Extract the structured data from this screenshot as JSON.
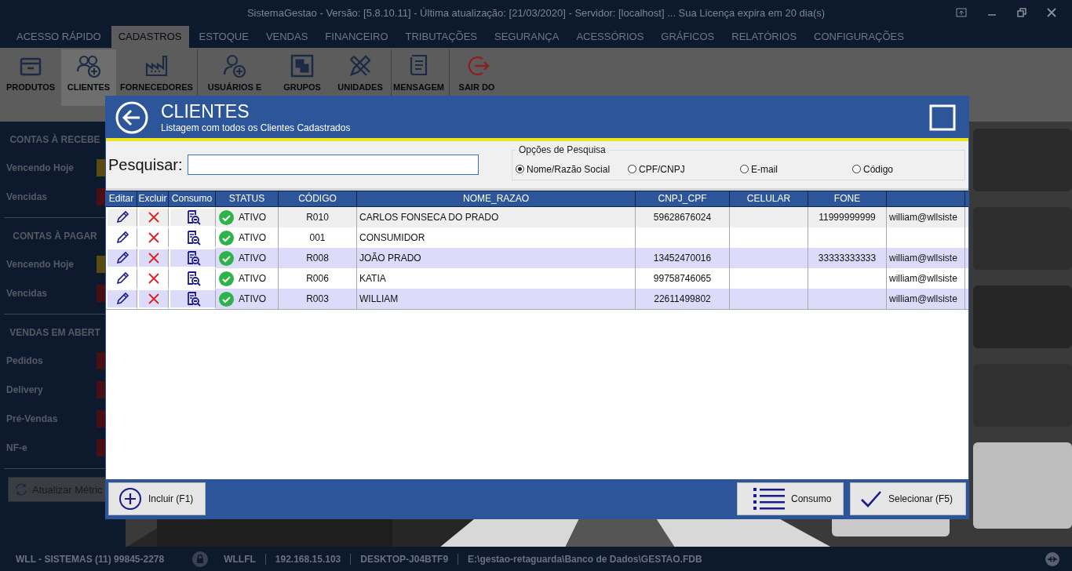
{
  "window": {
    "title": "SistemaGestao - Versão: [5.8.10.11] - Última atualização: [21/03/2020] - Servidor: [localhost] ... Sua Licença expira em 20 dia(s)"
  },
  "menu_tabs": [
    {
      "label": "ACESSO RÁPIDO",
      "selected": false
    },
    {
      "label": "CADASTROS",
      "selected": true
    },
    {
      "label": "ESTOQUE",
      "selected": false
    },
    {
      "label": "VENDAS",
      "selected": false
    },
    {
      "label": "FINANCEIRO",
      "selected": false
    },
    {
      "label": "TRIBUTAÇÕES",
      "selected": false
    },
    {
      "label": "SEGURANÇA",
      "selected": false
    },
    {
      "label": "ACESSÓRIOS",
      "selected": false
    },
    {
      "label": "GRÁFICOS",
      "selected": false
    },
    {
      "label": "RELATÓRIOS",
      "selected": false
    },
    {
      "label": "CONFIGURAÇÕES",
      "selected": false
    }
  ],
  "ribbon": [
    {
      "kind": "box",
      "label": "PRODUTOS",
      "selected": false
    },
    {
      "kind": "people",
      "label": "CLIENTES",
      "selected": true
    },
    {
      "kind": "factory",
      "label": "FORNECEDORES",
      "selected": false
    },
    {
      "kind": "user",
      "label": "USUÁRIOS E",
      "selected": false
    },
    {
      "kind": "group",
      "label": "GRUPOS",
      "selected": false
    },
    {
      "kind": "tools",
      "label": "UNIDADES",
      "selected": false
    },
    {
      "kind": "scroll",
      "label": "MENSAGEM",
      "selected": false
    },
    {
      "kind": "exit",
      "label": "SAIR DO",
      "selected": false
    }
  ],
  "sidebar": [
    {
      "heading": "CONTAS À RECEBE",
      "items": [
        {
          "label": "Vencendo Hoje",
          "color": "#5a4a14"
        },
        {
          "label": "Vencidas",
          "color": "#4a0f14"
        }
      ]
    },
    {
      "heading": "CONTAS À PAGAR",
      "items": [
        {
          "label": "Vencendo Hoje",
          "color": "#5a4a14"
        },
        {
          "label": "Vencidas",
          "color": "#4a0f14"
        }
      ]
    },
    {
      "heading": "VENDAS EM ABERT",
      "items": [
        {
          "label": "Pedidos",
          "color": "#4a0f14"
        },
        {
          "label": "Delivery",
          "color": "#4a0f14"
        },
        {
          "label": "Pré-Vendas",
          "color": "#4a0f14"
        },
        {
          "label": "NF-e",
          "color": "#4a0f14"
        }
      ]
    }
  ],
  "refresh_button": "Atualizar Métric",
  "dialog": {
    "title": "CLIENTES",
    "subtitle": "Listagem com todos os Clientes Cadastrados",
    "search": {
      "label": "Pesquisar:"
    },
    "search_options": {
      "title": "Opções de Pesquisa",
      "options": [
        {
          "label": "Nome/Razão Social",
          "selected": true
        },
        {
          "label": "CPF/CNPJ",
          "selected": false
        },
        {
          "label": "E-mail",
          "selected": false
        },
        {
          "label": "Código",
          "selected": false
        }
      ]
    },
    "table": {
      "columns": [
        "Editar",
        "Excluir",
        "Consumo",
        "STATUS",
        "CÓDIGO",
        "NOME_RAZAO",
        "CNPJ_CPF",
        "CELULAR",
        "FONE"
      ],
      "rows": [
        {
          "selected": true,
          "status": "ATIVO",
          "codigo": "R010",
          "nome_razao": "CARLOS FONSECA DO PRADO",
          "cnpj_cpf": "59628676024",
          "celular": "",
          "fone": "11999999999",
          "column_10": "william@wllsiste"
        },
        {
          "selected": false,
          "status": "ATIVO",
          "codigo": "001",
          "nome_razao": "CONSUMIDOR",
          "cnpj_cpf": "",
          "celular": "",
          "fone": "",
          "column_10": ""
        },
        {
          "selected": false,
          "status": "ATIVO",
          "codigo": "R008",
          "nome_razao": "JOÃO PRADO",
          "cnpj_cpf": "13452470016",
          "celular": "",
          "fone": "33333333333",
          "column_10": "william@wllsiste"
        },
        {
          "selected": false,
          "status": "ATIVO",
          "codigo": "R006",
          "nome_razao": "KATIA",
          "cnpj_cpf": "99758746065",
          "celular": "",
          "fone": "",
          "column_10": "william@wllsiste"
        },
        {
          "selected": false,
          "status": "ATIVO",
          "codigo": "R003",
          "nome_razao": "WILLIAM",
          "cnpj_cpf": "22611499802",
          "celular": "",
          "fone": "",
          "column_10": "william@wllsiste"
        }
      ]
    },
    "buttons": [
      {
        "kind": "add",
        "label": "Incluir (F1)"
      },
      {
        "kind": "list",
        "label": "Consumo"
      },
      {
        "kind": "check",
        "label": "Selecionar (F5)"
      }
    ]
  },
  "status_bar": [
    "WLL - SISTEMAS (11) 99845-2278",
    "WLLFL",
    "192.168.15.103",
    "DESKTOP-J04BTF9",
    "E:\\gestao-retaguarda\\Banco de Dados\\GESTAO.FDB"
  ]
}
